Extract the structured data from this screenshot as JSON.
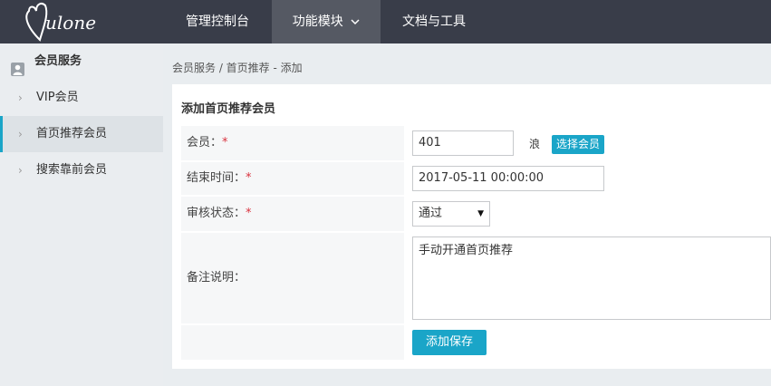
{
  "brand": {
    "logo_text": "Mulone"
  },
  "nav": {
    "items": [
      {
        "label": "管理控制台"
      },
      {
        "label": "功能模块"
      },
      {
        "label": "文档与工具"
      }
    ]
  },
  "sidebar": {
    "header": "会员服务",
    "items": [
      {
        "label": "VIP会员",
        "active": false
      },
      {
        "label": "首页推荐会员",
        "active": true
      },
      {
        "label": "搜索靠前会员",
        "active": false
      }
    ]
  },
  "breadcrumb": "会员服务 / 首页推荐 - 添加",
  "form": {
    "title": "添加首页推荐会员",
    "member": {
      "label": "会员：",
      "required_mark": "*",
      "value": "401",
      "resolved_name": "浪",
      "select_button": "选择会员"
    },
    "end_time": {
      "label": "结束时间：",
      "required_mark": "*",
      "value": "2017-05-11 00:00:00"
    },
    "review_status": {
      "label": "审核状态：",
      "required_mark": "*",
      "selected": "通过"
    },
    "remark": {
      "label": "备注说明：",
      "value": "手动开通首页推荐"
    },
    "save_button": "添加保存"
  },
  "colors": {
    "topbar": "#393d49",
    "accent": "#1aa5c8",
    "required": "#d9333f"
  }
}
